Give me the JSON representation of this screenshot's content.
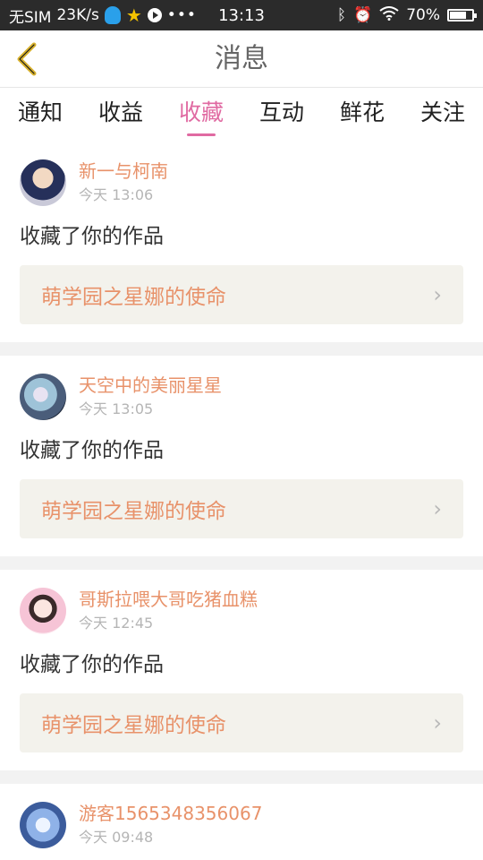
{
  "status_bar": {
    "carrier": "无SIM",
    "speed": "23K/s",
    "time": "13:13",
    "battery": "70%"
  },
  "header": {
    "title": "消息"
  },
  "tabs": [
    {
      "label": "通知",
      "active": false
    },
    {
      "label": "收益",
      "active": false
    },
    {
      "label": "收藏",
      "active": true
    },
    {
      "label": "互动",
      "active": false
    },
    {
      "label": "鲜花",
      "active": false
    },
    {
      "label": "关注",
      "active": false
    }
  ],
  "feed": [
    {
      "username": "新一与柯南",
      "time": "今天 13:06",
      "message": "收藏了你的作品",
      "work": "萌学园之星娜的使命"
    },
    {
      "username": "天空中的美丽星星",
      "time": "今天 13:05",
      "message": "收藏了你的作品",
      "work": "萌学园之星娜的使命"
    },
    {
      "username": "哥斯拉喂大哥吃猪血糕",
      "time": "今天 12:45",
      "message": "收藏了你的作品",
      "work": "萌学园之星娜的使命"
    },
    {
      "username": "游客1565348356067",
      "time": "今天 09:48"
    }
  ],
  "colors": {
    "accent": "#e06aa2",
    "username": "#e8926a",
    "work_bg": "#f3f2ec"
  }
}
